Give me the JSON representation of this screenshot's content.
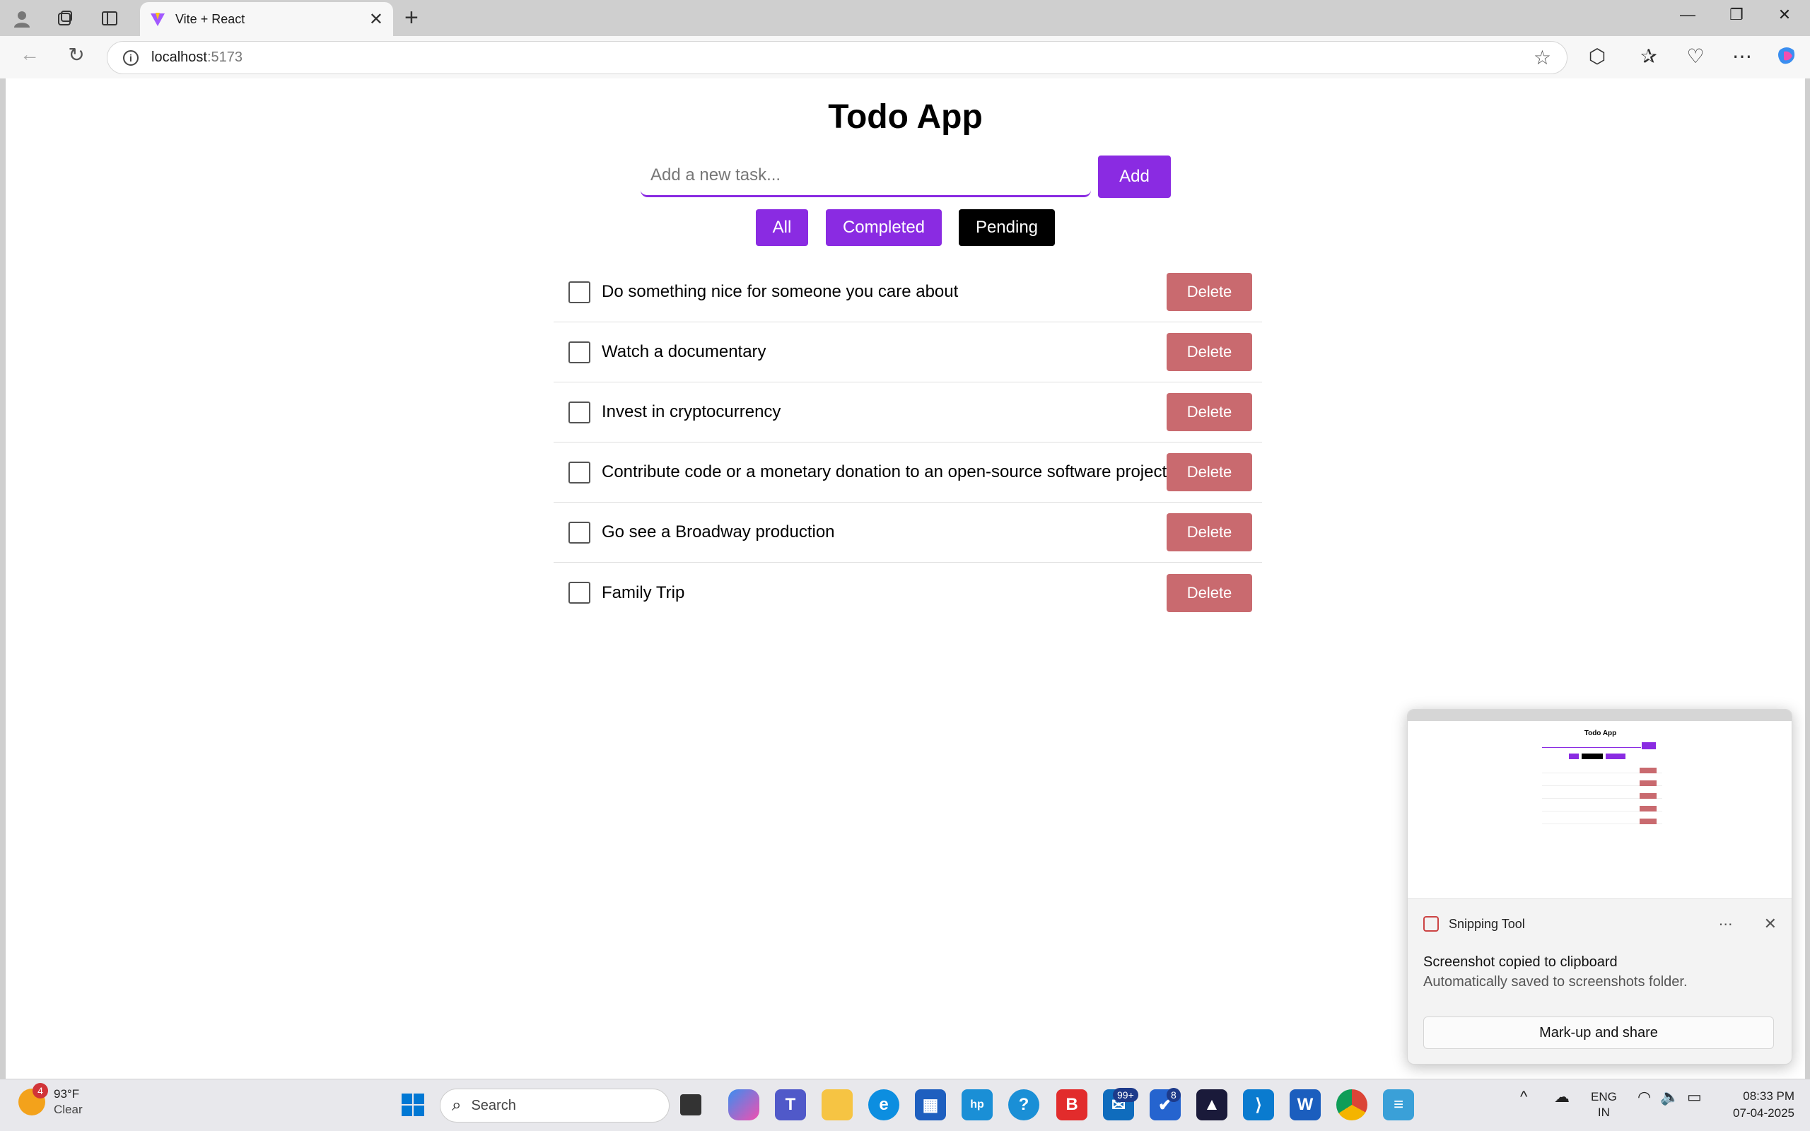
{
  "browser": {
    "tab_title": "Vite + React",
    "url_host": "localhost",
    "url_port": ":5173"
  },
  "app": {
    "title": "Todo App",
    "input_placeholder": "Add a new task...",
    "add_label": "Add",
    "filters": [
      "All",
      "Completed",
      "Pending"
    ],
    "delete_label": "Delete",
    "todos": [
      {
        "text": "Do something nice for someone you care about",
        "completed": false
      },
      {
        "text": "Watch a documentary",
        "completed": false
      },
      {
        "text": "Invest in cryptocurrency",
        "completed": false
      },
      {
        "text": "Contribute code or a monetary donation to an open-source software project",
        "completed": false
      },
      {
        "text": "Go see a Broadway production",
        "completed": false
      },
      {
        "text": "Family Trip",
        "completed": false
      }
    ]
  },
  "toast": {
    "app_name": "Snipping Tool",
    "message": "Screenshot copied to clipboard",
    "sub_message": "Automatically saved to screenshots folder.",
    "action_label": "Mark-up and share",
    "thumb_title": "Todo App"
  },
  "taskbar": {
    "weather_temp": "93°F",
    "weather_desc": "Clear",
    "weather_badge": "4",
    "search_label": "Search",
    "mail_badge": "99+",
    "todo_badge": "8",
    "language_top": "ENG",
    "language_bottom": "IN",
    "time": "08:33 PM",
    "date": "07-04-2025"
  },
  "colors": {
    "accent": "#8a2be2",
    "delete": "#c96a6f",
    "pending": "#000000"
  }
}
